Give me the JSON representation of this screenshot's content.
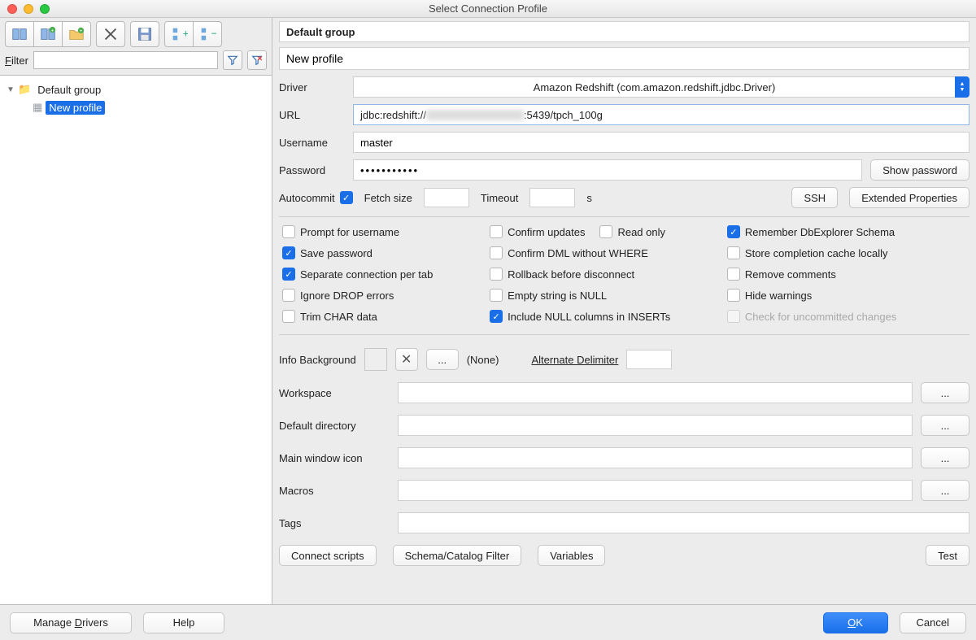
{
  "window": {
    "title": "Select Connection Profile"
  },
  "toolbar": {
    "filter_label": "Filter"
  },
  "tree": {
    "group": "Default group",
    "profile": "New profile"
  },
  "header": {
    "group": "Default group"
  },
  "profile": {
    "name": "New profile",
    "driver_label": "Driver",
    "driver": "Amazon Redshift (com.amazon.redshift.jdbc.Driver)",
    "url_label": "URL",
    "url_prefix": "jdbc:redshift://",
    "url_suffix": ":5439/tpch_100g",
    "username_label": "Username",
    "username": "master",
    "password_label": "Password",
    "password": "•••••••••••",
    "show_pw": "Show password",
    "autocommit_label": "Autocommit",
    "fetch_label": "Fetch size",
    "timeout_label": "Timeout",
    "timeout_unit": "s",
    "ssh": "SSH",
    "extprops": "Extended Properties"
  },
  "checks": {
    "c11": "Prompt for username",
    "c12": "Confirm updates",
    "c13": "Read only",
    "c14": "Remember DbExplorer Schema",
    "c21": "Save password",
    "c22": "Confirm DML without WHERE",
    "c23": "Store completion cache locally",
    "c31": "Separate connection per tab",
    "c32": "Rollback before disconnect",
    "c33": "Remove comments",
    "c41": "Ignore DROP errors",
    "c42": "Empty string is NULL",
    "c43": "Hide warnings",
    "c51": "Trim CHAR data",
    "c52": "Include NULL columns in INSERTs",
    "c53": "Check for uncommitted changes"
  },
  "info": {
    "label": "Info Background",
    "none": "(None)",
    "alt": "Alternate Delimiter",
    "dots": "..."
  },
  "paths": {
    "workspace": "Workspace",
    "defdir": "Default directory",
    "icon": "Main window icon",
    "macros": "Macros",
    "tags": "Tags",
    "dots": "..."
  },
  "actions": {
    "scripts": "Connect scripts",
    "filter": "Schema/Catalog Filter",
    "vars": "Variables",
    "test": "Test"
  },
  "bottom": {
    "drivers": "Manage Drivers",
    "help": "Help",
    "ok": "OK",
    "cancel": "Cancel"
  }
}
